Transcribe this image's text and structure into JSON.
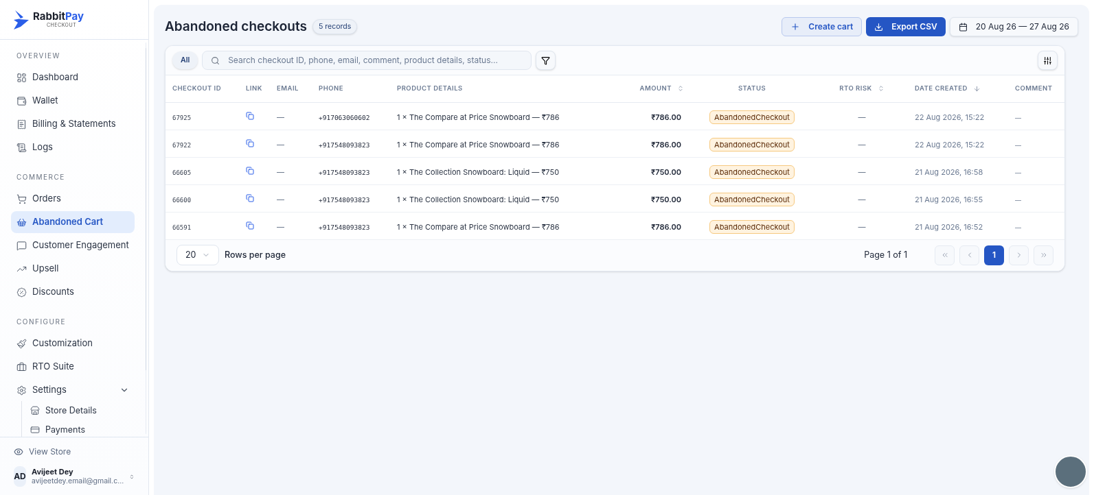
{
  "logo": {
    "name_first": "Rabbit",
    "name_second": "Pay",
    "tagline": "CHECKOUT"
  },
  "sidebar": {
    "sections": [
      {
        "title": "OVERVIEW",
        "items": [
          {
            "label": "Dashboard",
            "selected": false
          },
          {
            "label": "Wallet",
            "selected": false
          },
          {
            "label": "Billing & Statements",
            "selected": false
          },
          {
            "label": "Logs",
            "selected": false
          }
        ]
      },
      {
        "title": "COMMERCE",
        "items": [
          {
            "label": "Orders",
            "selected": false
          },
          {
            "label": "Abandoned Cart",
            "selected": true
          },
          {
            "label": "Customer Engagement",
            "selected": false
          },
          {
            "label": "Upsell",
            "selected": false
          },
          {
            "label": "Discounts",
            "selected": false
          }
        ]
      },
      {
        "title": "CONFIGURE",
        "items": [
          {
            "label": "Customization",
            "selected": false
          },
          {
            "label": "RTO Suite",
            "selected": false
          },
          {
            "label": "Settings",
            "selected": false,
            "expanded": true,
            "children": [
              {
                "label": "Store Details",
                "selected": false
              },
              {
                "label": "Payments",
                "selected": false
              }
            ]
          }
        ]
      }
    ],
    "view_store": "View Store",
    "user": {
      "initials": "AD",
      "name": "Avijeet Dey",
      "email": "avijeetdey.email@gmail.c..."
    }
  },
  "header": {
    "title": "Abandoned checkouts",
    "count": "5 records",
    "create": "Create cart",
    "export": "Export CSV",
    "date_range": "20 Aug 26 — 27 Aug 26"
  },
  "toolbar": {
    "chip": {
      "label": "All",
      "selected": true
    },
    "search": {
      "placeholder": "Search checkout ID, phone, email, comment, product details, status..."
    }
  },
  "table": {
    "columns": [
      {
        "label": "CHECKOUT ID",
        "sortable": false,
        "sorted": false
      },
      {
        "label": "LINK",
        "sortable": false,
        "sorted": false
      },
      {
        "label": "EMAIL",
        "sortable": false,
        "sorted": false
      },
      {
        "label": "PHONE",
        "sortable": false,
        "sorted": false
      },
      {
        "label": "PRODUCT DETAILS",
        "sortable": false,
        "sorted": false
      },
      {
        "label": "AMOUNT",
        "sortable": true,
        "sorted": false
      },
      {
        "label": "STATUS",
        "sortable": false,
        "sorted": false
      },
      {
        "label": "RTO RISK",
        "sortable": true,
        "sorted": false
      },
      {
        "label": "DATE CREATED",
        "sortable": true,
        "sorted": true
      },
      {
        "label": "COMMENT",
        "sortable": false,
        "sorted": false
      }
    ],
    "rows": [
      {
        "id": "67925",
        "email": "—",
        "phone": "+917063060602",
        "product": "1 × The Compare at Price Snowboard — ₹786",
        "amount": "₹786.00",
        "status": "AbandonedCheckout",
        "rto": "—",
        "date": "22 Aug 2026, 15:22",
        "comment": "—"
      },
      {
        "id": "67922",
        "email": "—",
        "phone": "+917548093823",
        "product": "1 × The Compare at Price Snowboard — ₹786",
        "amount": "₹786.00",
        "status": "AbandonedCheckout",
        "rto": "—",
        "date": "22 Aug 2026, 15:22",
        "comment": "—"
      },
      {
        "id": "66605",
        "email": "—",
        "phone": "+917548093823",
        "product": "1 × The Collection Snowboard: Liquid — ₹750",
        "amount": "₹750.00",
        "status": "AbandonedCheckout",
        "rto": "—",
        "date": "21 Aug 2026, 16:58",
        "comment": "—"
      },
      {
        "id": "66600",
        "email": "—",
        "phone": "+917548093823",
        "product": "1 × The Collection Snowboard: Liquid — ₹750",
        "amount": "₹750.00",
        "status": "AbandonedCheckout",
        "rto": "—",
        "date": "21 Aug 2026, 16:55",
        "comment": "—"
      },
      {
        "id": "66591",
        "email": "—",
        "phone": "+917548093823",
        "product": "1 × The Compare at Price Snowboard — ₹786",
        "amount": "₹786.00",
        "status": "AbandonedCheckout",
        "rto": "—",
        "date": "21 Aug 2026, 16:52",
        "comment": "—"
      }
    ]
  },
  "pagination": {
    "rows_per_page": "20",
    "rows_label": "Rows per page",
    "page_info": "Page 1 of 1",
    "nav": [
      {
        "kind": "first",
        "disabled": true
      },
      {
        "kind": "prev",
        "disabled": true
      },
      {
        "kind": "page",
        "label": "1",
        "selected": true
      },
      {
        "kind": "next",
        "disabled": true
      },
      {
        "kind": "last",
        "disabled": true
      }
    ]
  }
}
